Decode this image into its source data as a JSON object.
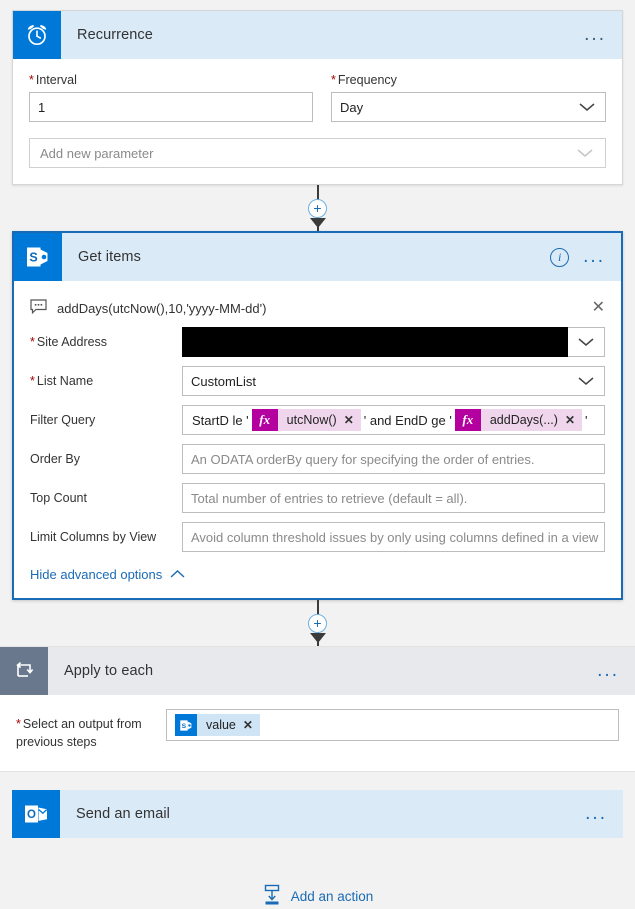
{
  "colors": {
    "accent": "#0078d7",
    "header_blue": "#daeaf7",
    "header_gray": "#e7e9ec",
    "selected_border": "#1a6bb5",
    "slate_tile": "#69788c",
    "token_magenta": "#b4009e",
    "token_pink": "#f0d6ec",
    "required_red": "#a80000",
    "link_blue": "#1a6bb5"
  },
  "recurrence": {
    "title": "Recurrence",
    "icon": "alarm-clock-icon",
    "menu": "...",
    "interval": {
      "label": "Interval",
      "required": true,
      "value": "1"
    },
    "frequency": {
      "label": "Frequency",
      "required": true,
      "value": "Day",
      "chevron": "chevron-down-icon"
    },
    "add_parameter": {
      "placeholder": "Add new parameter",
      "chevron": "chevron-down-icon"
    }
  },
  "get_items": {
    "title": "Get items",
    "icon": "sharepoint-icon",
    "info": "i",
    "menu": "...",
    "selected": true,
    "comment": {
      "icon": "comment-icon",
      "text": "addDays(utcNow(),10,'yyyy-MM-dd')",
      "close": "✕"
    },
    "fields": [
      {
        "label": "Site Address",
        "required": true,
        "type": "redacted-dropdown",
        "value": "",
        "chevron": "chevron-down-icon"
      },
      {
        "label": "List Name",
        "required": true,
        "type": "dropdown",
        "value": "CustomList",
        "chevron": "chevron-down-icon"
      },
      {
        "label": "Filter Query",
        "required": false,
        "type": "tokens",
        "value": ""
      },
      {
        "label": "Order By",
        "required": false,
        "type": "text",
        "placeholder": "An ODATA orderBy query for specifying the order of entries."
      },
      {
        "label": "Top Count",
        "required": false,
        "type": "text",
        "placeholder": "Total number of entries to retrieve (default = all)."
      },
      {
        "label": "Limit Columns by View",
        "required": false,
        "type": "dropdown",
        "placeholder": "Avoid column threshold issues by only using columns defined in a view",
        "chevron": "chevron-down-icon"
      }
    ],
    "filter_query_tokens": [
      {
        "kind": "text",
        "text": "StartD le '"
      },
      {
        "kind": "expression",
        "fx": "fx",
        "text": "utcNow()",
        "remove": "✕"
      },
      {
        "kind": "text",
        "text": "' and EndD ge '"
      },
      {
        "kind": "expression",
        "fx": "fx",
        "text": "addDays(...)",
        "remove": "✕"
      },
      {
        "kind": "text",
        "text": "'"
      }
    ],
    "advanced_link": {
      "label": "Hide advanced options",
      "chevron": "chevron-up-icon"
    }
  },
  "apply_to_each": {
    "title": "Apply to each",
    "icon": "loop-icon",
    "menu": "...",
    "select_output": {
      "label_line1": "Select an output from",
      "label_line2": "previous steps",
      "required": true,
      "token": {
        "icon": "sharepoint-icon",
        "text": "value",
        "remove": "✕"
      }
    }
  },
  "send_email": {
    "title": "Send an email",
    "icon": "outlook-icon",
    "menu": "..."
  },
  "footer": {
    "add_action": {
      "label": "Add an action",
      "icon": "add-action-icon"
    }
  },
  "connectors": {
    "plus": "+",
    "arrow": "arrow-down-icon"
  }
}
